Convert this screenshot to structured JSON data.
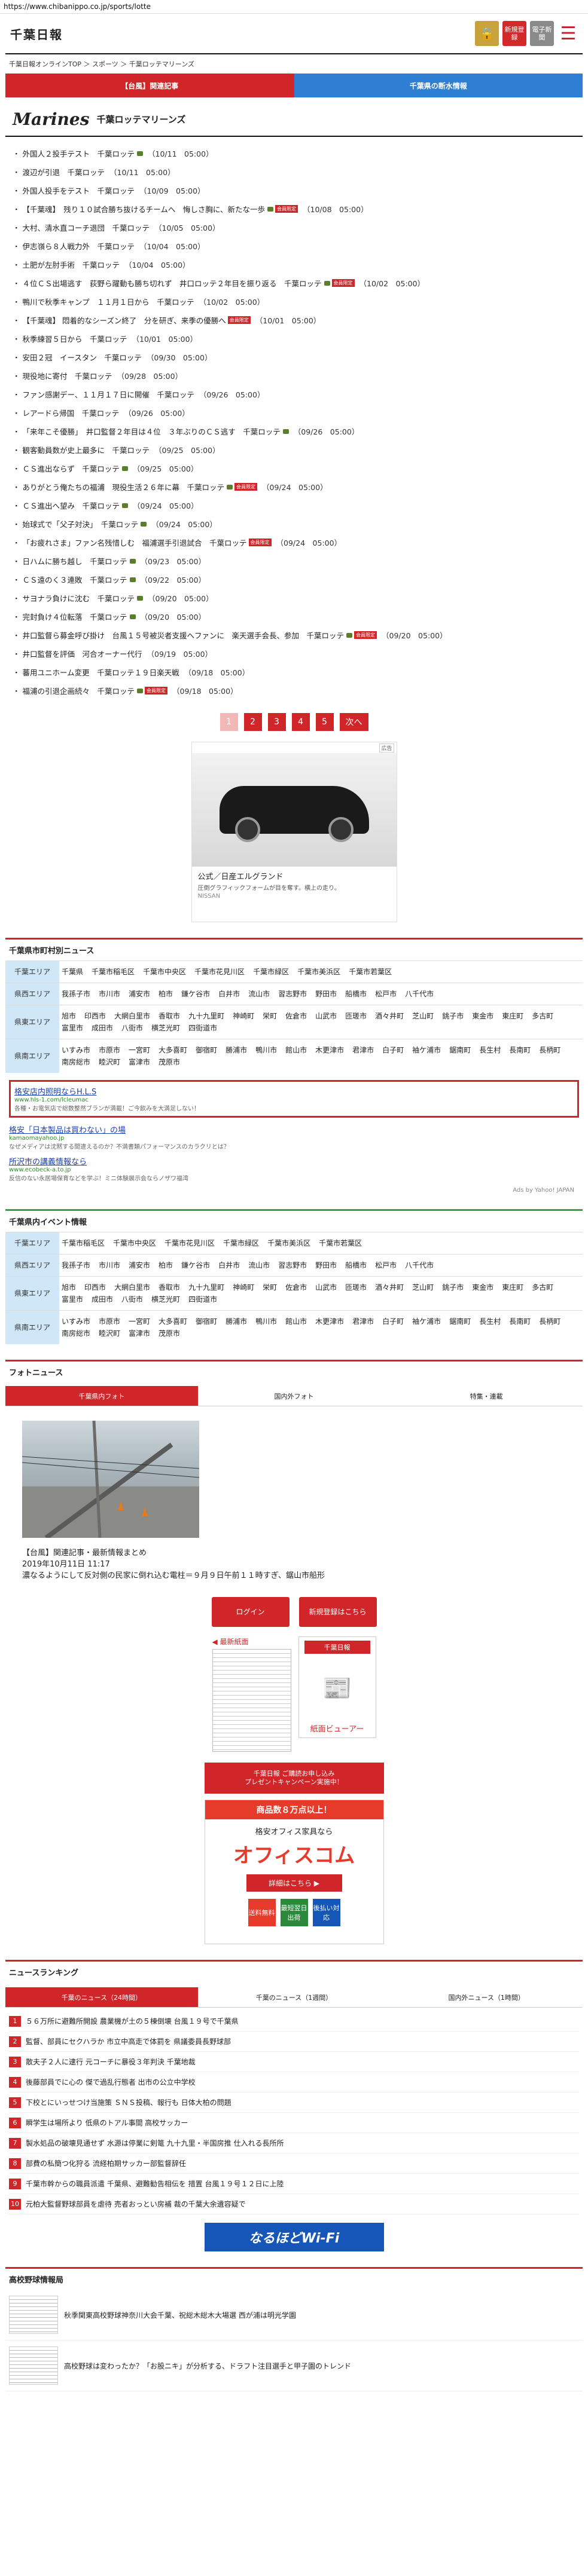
{
  "browser": {
    "url": "https://www.chibanippo.co.jp/sports/lotte"
  },
  "header": {
    "logo": "千葉日報",
    "lock_icon": "lock-icon",
    "signup_label": "新規登録",
    "epaper_label": "電子新聞",
    "menu_icon": "hamburger-menu-icon"
  },
  "breadcrumb": "千葉日報オンラインTOP ＞ スポーツ ＞ 千葉ロッテマリーンズ",
  "top_tabs": {
    "left": "【台風】関連記事",
    "right": "千葉県の断水情報"
  },
  "team": {
    "logo_text": "Marines",
    "name": "千葉ロッテマリーンズ"
  },
  "articles": [
    {
      "title": "外国人２投手テスト　千葉ロッテ",
      "date": "（10/11　05:00）",
      "camera": true,
      "members": false
    },
    {
      "title": "渡辺が引退　千葉ロッテ",
      "date": "（10/11　05:00）",
      "camera": false,
      "members": false
    },
    {
      "title": "外国人投手をテスト　千葉ロッテ",
      "date": "（10/09　05:00）",
      "camera": false,
      "members": false
    },
    {
      "title": "【千葉魂】　残り１０試合勝ち抜けるチームへ　悔しさ胸に、新たな一歩",
      "date": "（10/08　05:00）",
      "camera": true,
      "members": true
    },
    {
      "title": "大村、清水直コーチ退団　千葉ロッテ",
      "date": "（10/05　05:00）",
      "camera": false,
      "members": false
    },
    {
      "title": "伊志嶺ら８人戦力外　千葉ロッテ",
      "date": "（10/04　05:00）",
      "camera": false,
      "members": false
    },
    {
      "title": "土肥が左肘手術　千葉ロッテ",
      "date": "（10/04　05:00）",
      "camera": false,
      "members": false
    },
    {
      "title": "４位ＣＳ出場逃す　荻野ら躍動も勝ち切れず　井口ロッテ２年目を振り返る　千葉ロッテ",
      "date": "（10/02　05:00）",
      "camera": true,
      "members": true
    },
    {
      "title": "鴨川で秋季キャンプ　１１月１日から　千葉ロッテ",
      "date": "（10/02　05:00）",
      "camera": false,
      "members": false
    },
    {
      "title": "【千葉魂】 悶着的なシーズン終了　分を研ぎ、来季の優勝へ",
      "date": "（10/01　05:00）",
      "camera": false,
      "members": true
    },
    {
      "title": "秋季練習５日から　千葉ロッテ",
      "date": "（10/01　05:00）",
      "camera": false,
      "members": false
    },
    {
      "title": "安田２冠　イースタン　千葉ロッテ",
      "date": "（09/30　05:00）",
      "camera": false,
      "members": false
    },
    {
      "title": "現役地に寄付　千葉ロッテ",
      "date": "（09/28　05:00）",
      "camera": false,
      "members": false
    },
    {
      "title": "ファン感謝デー、１１月１７日に開催　千葉ロッテ",
      "date": "（09/26　05:00）",
      "camera": false,
      "members": false
    },
    {
      "title": "レアードら帰国　千葉ロッテ",
      "date": "（09/26　05:00）",
      "camera": false,
      "members": false
    },
    {
      "title": "「来年こそ優勝」　井口監督２年目は４位　３年ぶりのＣＳ逃す　千葉ロッテ",
      "date": "（09/26　05:00）",
      "camera": true,
      "members": false
    },
    {
      "title": "観客動員数が史上最多に　千葉ロッテ",
      "date": "（09/25　05:00）",
      "camera": false,
      "members": false
    },
    {
      "title": "ＣＳ進出ならず　千葉ロッテ",
      "date": "（09/25　05:00）",
      "camera": true,
      "members": false
    },
    {
      "title": "ありがとう俺たちの福浦　現役生活２６年に幕　千葉ロッテ",
      "date": "（09/24　05:00）",
      "camera": true,
      "members": true
    },
    {
      "title": "ＣＳ進出へ望み　千葉ロッテ",
      "date": "（09/24　05:00）",
      "camera": true,
      "members": false
    },
    {
      "title": "始球式で「父子対決」　千葉ロッテ",
      "date": "（09/24　05:00）",
      "camera": true,
      "members": false
    },
    {
      "title": "「お疲れさま」ファン名残惜しむ　福浦選手引退試合　千葉ロッテ",
      "date": "（09/24　05:00）",
      "camera": false,
      "members": true
    },
    {
      "title": "日ハムに勝ち越し　千葉ロッテ",
      "date": "（09/23　05:00）",
      "camera": true,
      "members": false
    },
    {
      "title": "ＣＳ遠のく３連敗　千葉ロッテ",
      "date": "（09/22　05:00）",
      "camera": true,
      "members": false
    },
    {
      "title": "サヨナラ負けに沈む　千葉ロッテ",
      "date": "（09/20　05:00）",
      "camera": true,
      "members": false
    },
    {
      "title": "完封負け４位転落　千葉ロッテ",
      "date": "（09/20　05:00）",
      "camera": true,
      "members": false
    },
    {
      "title": "井口監督ら募金呼び掛け　台風１５号被災者支援へファンに　楽天選手会長、参加　千葉ロッテ",
      "date": "（09/20　05:00）",
      "camera": true,
      "members": true
    },
    {
      "title": "井口監督を評価　河合オーナー代行",
      "date": "（09/19　05:00）",
      "camera": false,
      "members": false
    },
    {
      "title": "蕃用ユニホーム変更　千葉ロッテ１９日楽天戦",
      "date": "（09/18　05:00）",
      "camera": false,
      "members": false
    },
    {
      "title": "福浦の引退企画続々　千葉ロッテ",
      "date": "（09/18　05:00）",
      "camera": true,
      "members": true
    }
  ],
  "members_badge": "会員限定",
  "pager": {
    "pages": [
      "1",
      "2",
      "3",
      "4",
      "5"
    ],
    "current": "1",
    "next": "次へ"
  },
  "ad": {
    "label": "広告",
    "title": "公式／日産エルグランド",
    "desc": "圧倒グラフィックフォームが目を奪す。横上の走り。",
    "brand": "NISSAN"
  },
  "city_news": {
    "title": "千葉県市町村別ニュース",
    "areas": [
      {
        "name": "千葉エリア",
        "cities": [
          "千葉県",
          "千葉市稲毛区",
          "千葉市中央区",
          "千葉市花見川区",
          "千葉市緑区",
          "千葉市美浜区",
          "千葉市若葉区"
        ]
      },
      {
        "name": "県西エリア",
        "cities": [
          "我孫子市",
          "市川市",
          "浦安市",
          "柏市",
          "鎌ケ谷市",
          "白井市",
          "流山市",
          "習志野市",
          "野田市",
          "船橋市",
          "松戸市",
          "八千代市"
        ]
      },
      {
        "name": "県東エリア",
        "cities": [
          "旭市",
          "印西市",
          "大網白里市",
          "香取市",
          "九十九里町",
          "神崎町",
          "栄町",
          "佐倉市",
          "山武市",
          "匝瑳市",
          "酒々井町",
          "芝山町",
          "銚子市",
          "東金市",
          "東庄町",
          "多古町",
          "富里市",
          "成田市",
          "八街市",
          "横芝光町",
          "四街道市"
        ]
      },
      {
        "name": "県南エリア",
        "cities": [
          "いすみ市",
          "市原市",
          "一宮町",
          "大多喜町",
          "御宿町",
          "勝浦市",
          "鴨川市",
          "館山市",
          "木更津市",
          "君津市",
          "白子町",
          "袖ケ浦市",
          "鋸南町",
          "長生村",
          "長南町",
          "長柄町",
          "南房総市",
          "睦沢町",
          "富津市",
          "茂原市"
        ]
      }
    ]
  },
  "text_ads": {
    "featured": {
      "title": "格安店内照明ならH.L.S",
      "url": "www.hls-1.com/lcleumac",
      "desc": "各種・お電気店で総数整然ブランが満載！ご今飲みを大満足しない！"
    },
    "items": [
      {
        "title": "格安「日本製品は買わない」の場",
        "url": "kamaomayahoo.jp",
        "desc": "なぜメディアは沈黙する間違えるのか？不満書類パフォーマンスのカラクリとは？"
      },
      {
        "title": "所沢市の講義情報なら",
        "url": "www.ecobeck-a.to.jp",
        "desc": "反信のない永居場保育などを学ぶ！ミニ体験展示会ならノザワ福湾"
      }
    ],
    "ads_by": "Ads by Yahoo! JAPAN"
  },
  "event_info": {
    "title": "千葉県内イベント情報",
    "areas": [
      {
        "name": "千葉エリア",
        "cities": [
          "千葉市稲毛区",
          "千葉市中央区",
          "千葉市花見川区",
          "千葉市緑区",
          "千葉市美浜区",
          "千葉市若葉区"
        ]
      },
      {
        "name": "県西エリア",
        "cities": [
          "我孫子市",
          "市川市",
          "浦安市",
          "柏市",
          "鎌ケ谷市",
          "白井市",
          "流山市",
          "習志野市",
          "野田市",
          "船橋市",
          "松戸市",
          "八千代市"
        ]
      },
      {
        "name": "県東エリア",
        "cities": [
          "旭市",
          "印西市",
          "大網白里市",
          "香取市",
          "九十九里町",
          "神崎町",
          "栄町",
          "佐倉市",
          "山武市",
          "匝瑳市",
          "酒々井町",
          "芝山町",
          "銚子市",
          "東金市",
          "東庄町",
          "多古町",
          "富里市",
          "成田市",
          "八街市",
          "横芝光町",
          "四街道市"
        ]
      },
      {
        "name": "県南エリア",
        "cities": [
          "いすみ市",
          "市原市",
          "一宮町",
          "大多喜町",
          "御宿町",
          "勝浦市",
          "鴨川市",
          "館山市",
          "木更津市",
          "君津市",
          "白子町",
          "袖ケ浦市",
          "鋸南町",
          "長生村",
          "長南町",
          "長柄町",
          "南房総市",
          "睦沢町",
          "富津市",
          "茂原市"
        ]
      }
    ]
  },
  "photo_news": {
    "title": "フォトニュース",
    "tabs": [
      "千葉県内フォト",
      "国内外フォト",
      "特集・連載"
    ],
    "caption_1": "【台風】関連記事・最新情報まとめ",
    "caption_2": "2019年10月11日 11:17",
    "caption_3": "濃なるようにして反対側の民家に倒れ込む電柱＝９月９日午前１１時すぎ、鋸山市船形"
  },
  "widgets": {
    "login": "ログイン",
    "signup": "新規登録はこちら",
    "latest_paper": "◀ 最新紙面",
    "viewer_head": "千葉日報",
    "viewer_icon": "newspaper-reader-icon",
    "viewer_label": "紙面ビューアー",
    "promo_1": "千葉日報 ご購読お申し込み",
    "promo_2": "プレゼントキャンペーン実施中！",
    "office_top": "商品数８万点以上！",
    "office_sub": "格安オフィス家具なら",
    "office_name": "オフィスコム",
    "office_cta": "詳細はこちら ▶",
    "office_feats": [
      "送料無料",
      "最短翌日出荷",
      "後払い対応"
    ]
  },
  "ranking": {
    "title": "ニュースランキング",
    "tabs": [
      "千葉のニュース（24時間）",
      "千葉のニュース（1週間）",
      "国内外ニュース（1時間）"
    ],
    "items": [
      "５６万所に避難所開設 農業機が土の５棟倒壊 台風１９号で千葉県",
      "監督、部員にセクハラか 市立中高走で体罰を 県議委員長野球部",
      "散夫子２人に逮行 元コーチに暴役３年判決 千葉地裁",
      "後藤部員でに心の 傑で過乱行態者 出市の公立中学校",
      "下校とにいっせつけ当施策 ＳＮＳ投稿、報行も 日体大柏の問題",
      "瞬学生は場所より 低県のトアル事間 高校サッカー",
      "製水処品の破壊見通せず 水源は停業に剣篭 九十九里・半国房推 仕入れる長所所",
      "部費の私簡つ化狩る 流経柏期サッカー部監督辞任",
      "千葉市幹からの職員派遣 千葉県、避難勧告相伝を 措置 台風１９号１２日に上陸",
      "元柏大監督野球部員を虐待 売者おっとい房補 裁の千葉大余遺容疑で"
    ]
  },
  "wifi_banner": "なるほどWi-Fi",
  "high_school": {
    "title": "高校野球情報局",
    "items": [
      "秋季関東高校野球神奈川大会千葉、祝総木総木大場選 西が浦は明光学園",
      "高校野球は変わったか？「お股ニキ」が分析する、ドラフト注目選手と甲子園のトレンド"
    ]
  }
}
